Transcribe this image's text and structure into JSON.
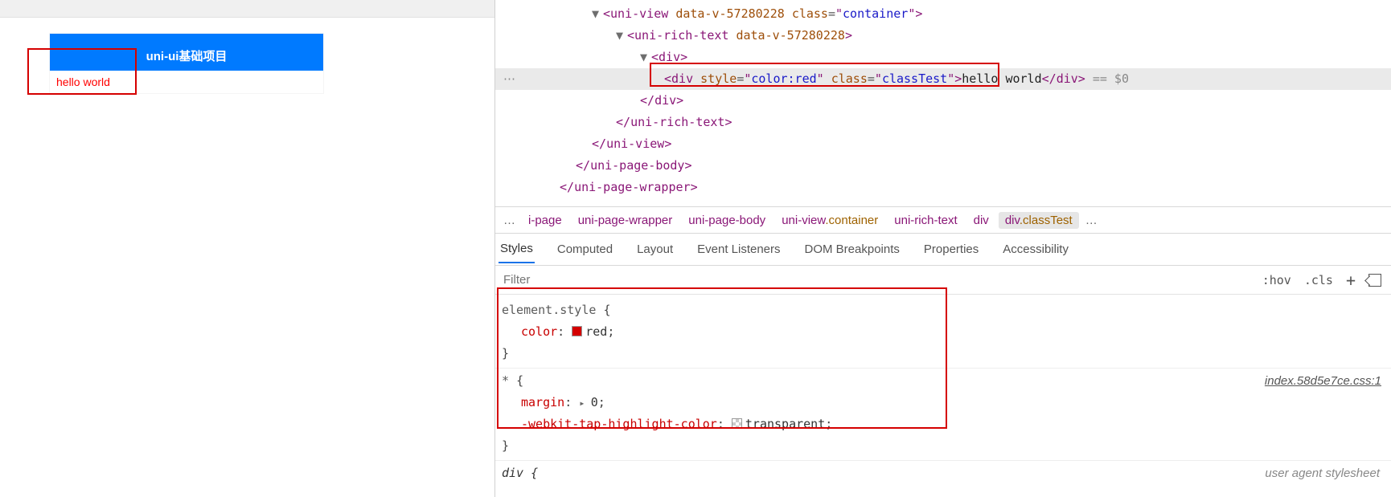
{
  "app": {
    "title": "uni-ui基础项目",
    "body_text": "hello world"
  },
  "dom": {
    "lines": [
      {
        "indent": 120,
        "caret": "▼",
        "open": "<",
        "tag": "uni-view",
        "attrs": [
          [
            "data-v-57280228",
            ""
          ],
          [
            "class",
            "container"
          ]
        ],
        "close": ">"
      },
      {
        "indent": 150,
        "caret": "▼",
        "open": "<",
        "tag": "uni-rich-text",
        "attrs": [
          [
            "data-v-57280228",
            ""
          ]
        ],
        "close": ">"
      },
      {
        "indent": 180,
        "caret": "▼",
        "open": "<",
        "tag": "div",
        "attrs": [],
        "close": ">"
      },
      {
        "indent": 210,
        "caret": "",
        "open": "<",
        "tag": "div",
        "attrs": [
          [
            "style",
            "color:red"
          ],
          [
            "class",
            "classTest"
          ]
        ],
        "close": ">",
        "text": "hello world",
        "endtag": "div",
        "eq": " == $0",
        "highlight": true,
        "ellipsis": true
      },
      {
        "indent": 180,
        "caret": "",
        "endonly": "div"
      },
      {
        "indent": 150,
        "caret": "",
        "endonly": "uni-rich-text"
      },
      {
        "indent": 120,
        "caret": "",
        "endonly": "uni-view"
      },
      {
        "indent": 100,
        "caret": "",
        "endonly": "uni-page-body"
      },
      {
        "indent": 80,
        "caret": "",
        "endonly": "uni-page-wrapper"
      }
    ]
  },
  "breadcrumbs": {
    "leading_ellipsis": "…",
    "items": [
      {
        "tag": "i-page",
        "cls": ""
      },
      {
        "tag": "uni-page-wrapper",
        "cls": ""
      },
      {
        "tag": "uni-page-body",
        "cls": ""
      },
      {
        "tag": "uni-view",
        "cls": ".container"
      },
      {
        "tag": "uni-rich-text",
        "cls": ""
      },
      {
        "tag": "div",
        "cls": ""
      },
      {
        "tag": "div",
        "cls": ".classTest",
        "active": true
      }
    ],
    "trailing_ellipsis": "…"
  },
  "tabs": {
    "items": [
      "Styles",
      "Computed",
      "Layout",
      "Event Listeners",
      "DOM Breakpoints",
      "Properties",
      "Accessibility"
    ],
    "active": "Styles"
  },
  "filter": {
    "placeholder": "Filter",
    "hov": ":hov",
    "cls": ".cls"
  },
  "styles": {
    "rule1": {
      "selector": "element.style",
      "props": [
        {
          "name": "color",
          "swatch": "red",
          "value": "red"
        }
      ]
    },
    "rule2": {
      "selector": "*",
      "origin": "index.58d5e7ce.css:1",
      "props": [
        {
          "name": "margin",
          "tri": true,
          "value": "0"
        },
        {
          "name": "-webkit-tap-highlight-color",
          "swatch": "checker",
          "value": "transparent"
        }
      ]
    },
    "rule3_selector": "div {",
    "agent_label": "user agent stylesheet"
  }
}
